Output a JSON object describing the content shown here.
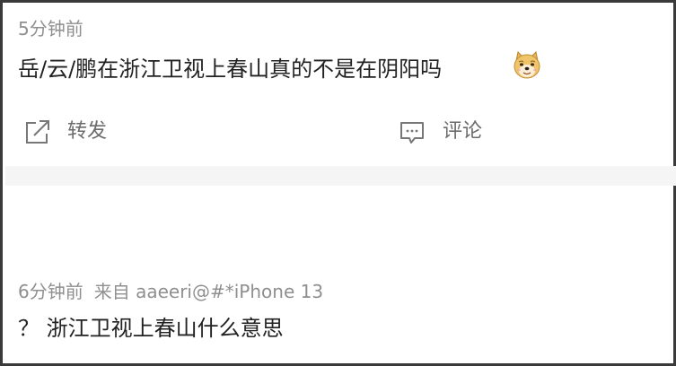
{
  "post1": {
    "time": "5分钟前",
    "text": "岳/云/鹏在浙江卫视上春山真的不是在阴阳吗",
    "emoji": "doge-emoji"
  },
  "actions": {
    "forward_label": "转发",
    "comment_label": "评论"
  },
  "post2": {
    "time": "6分钟前",
    "source": "来自 aaeeri@#*iPhone 13",
    "text": "？ 浙江卫视上春山什么意思"
  }
}
